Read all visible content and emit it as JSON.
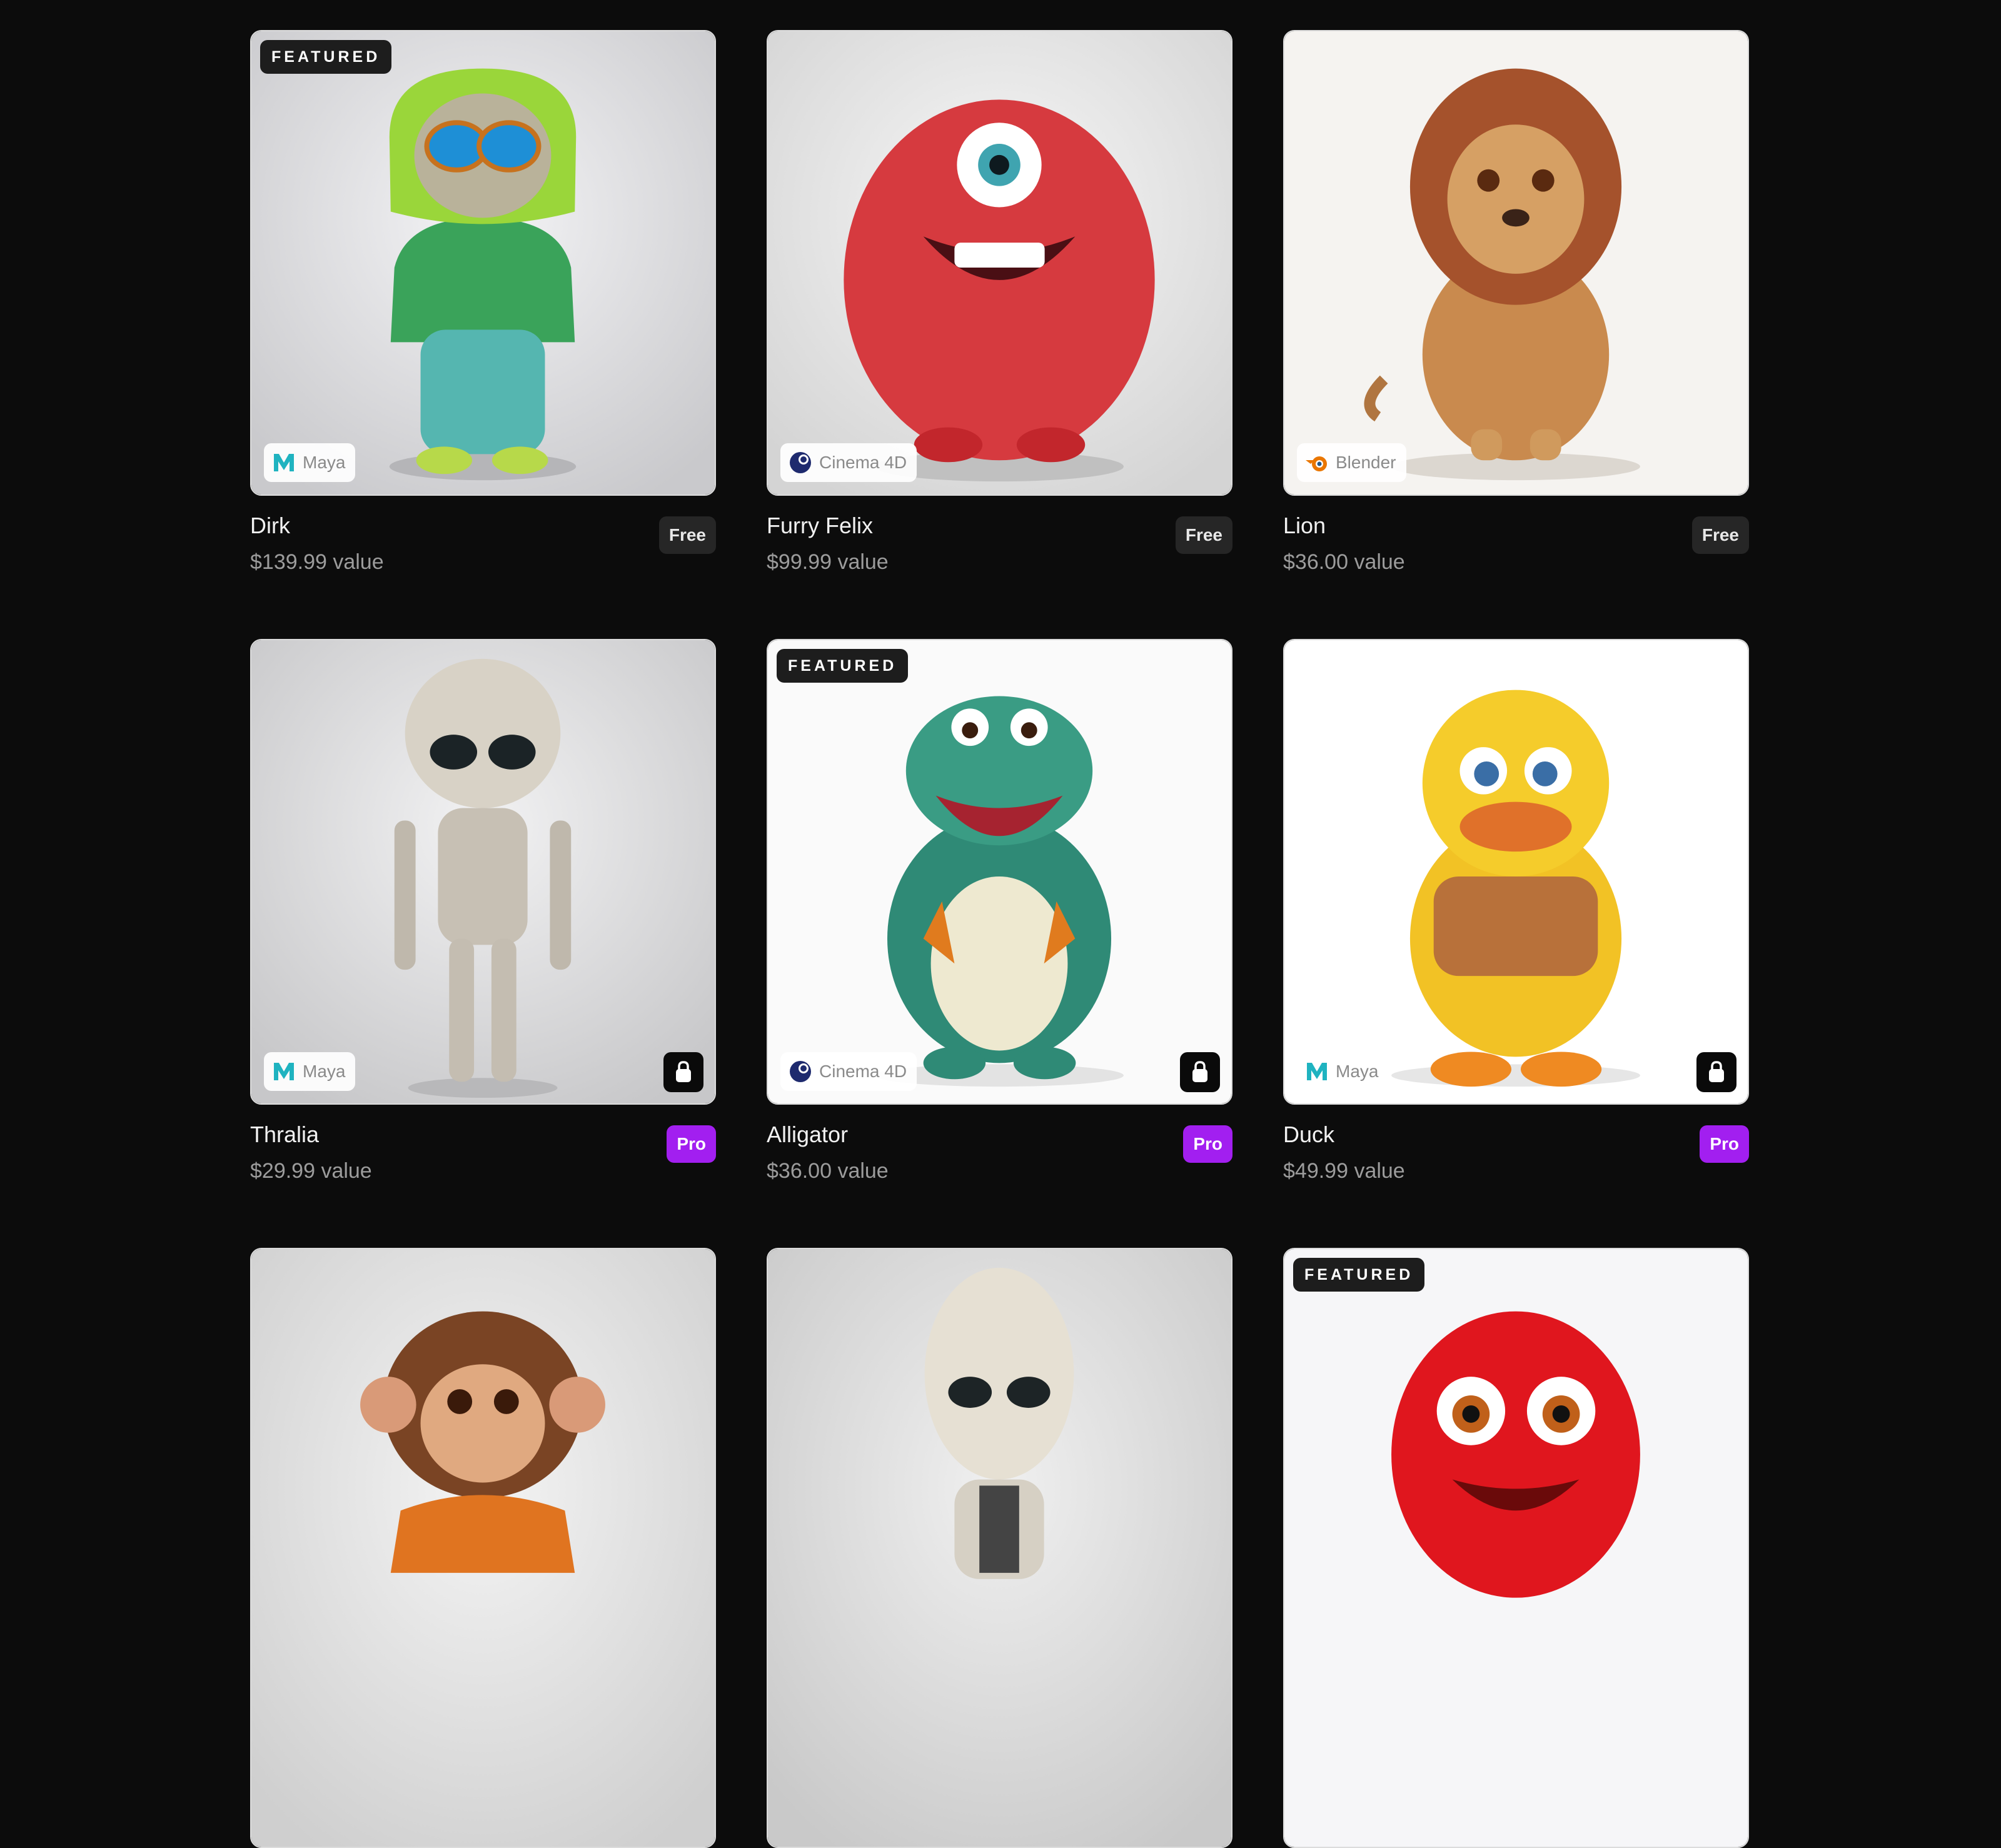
{
  "cards": [
    {
      "name": "Dirk",
      "value": "$139.99 value",
      "badge": "Free",
      "software": "Maya",
      "featured": "FEATURED"
    },
    {
      "name": "Furry Felix",
      "value": "$99.99 value",
      "badge": "Free",
      "software": "Cinema 4D"
    },
    {
      "name": "Lion",
      "value": "$36.00 value",
      "badge": "Free",
      "software": "Blender"
    },
    {
      "name": "Thralia",
      "value": "$29.99 value",
      "badge": "Pro",
      "software": "Maya"
    },
    {
      "name": "Alligator",
      "value": "$36.00 value",
      "badge": "Pro",
      "software": "Cinema 4D",
      "featured": "FEATURED"
    },
    {
      "name": "Duck",
      "value": "$49.99 value",
      "badge": "Pro",
      "software": "Maya"
    },
    {},
    {},
    {
      "featured": "FEATURED"
    }
  ],
  "colors": {
    "pro": "#a21ff0",
    "free": "#262626",
    "background": "#0c0c0c"
  }
}
